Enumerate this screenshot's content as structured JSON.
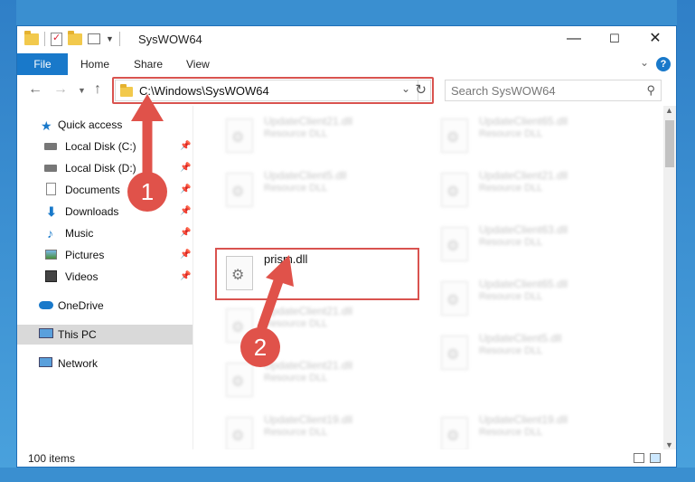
{
  "window": {
    "title": "SysWOW64"
  },
  "ribbon": {
    "tabs": [
      {
        "label": "File"
      },
      {
        "label": "Home"
      },
      {
        "label": "Share"
      },
      {
        "label": "View"
      }
    ],
    "help": "?"
  },
  "nav": {
    "address": "C:\\Windows\\SysWOW64",
    "search_placeholder": "Search SysWOW64"
  },
  "sidebar": {
    "items": [
      {
        "label": "Quick access",
        "icon": "star-icon"
      },
      {
        "label": "Local Disk (C:)",
        "icon": "drive-icon",
        "pinned": true
      },
      {
        "label": "Local Disk (D:)",
        "icon": "drive-icon",
        "pinned": true
      },
      {
        "label": "Documents",
        "icon": "documents-icon",
        "pinned": true
      },
      {
        "label": "Downloads",
        "icon": "download-icon",
        "pinned": true
      },
      {
        "label": "Music",
        "icon": "music-icon",
        "pinned": true
      },
      {
        "label": "Pictures",
        "icon": "pictures-icon",
        "pinned": true
      },
      {
        "label": "Videos",
        "icon": "videos-icon",
        "pinned": true
      },
      {
        "label": "OneDrive",
        "icon": "cloud-icon"
      },
      {
        "label": "This PC",
        "icon": "computer-icon",
        "selected": true
      },
      {
        "label": "Network",
        "icon": "network-icon"
      }
    ]
  },
  "files": {
    "left": [
      {
        "name": "UpdateClient21.dll",
        "type": "Resource DLL"
      },
      {
        "name": "UpdateClient5.dll",
        "type": "Resource DLL"
      },
      {
        "name": "prism.dll",
        "type": ""
      },
      {
        "name": "UpdateClient21.dll",
        "type": "Resource DLL"
      },
      {
        "name": "UpdateClient21.dll",
        "type": "Resource DLL"
      },
      {
        "name": "UpdateClient19.dll",
        "type": "Resource DLL"
      }
    ],
    "right": [
      {
        "name": "UpdateClient65.dll",
        "type": "Resource DLL"
      },
      {
        "name": "UpdateClient21.dll",
        "type": "Resource DLL"
      },
      {
        "name": "UpdateClient63.dll",
        "type": "Resource DLL"
      },
      {
        "name": "UpdateClient65.dll",
        "type": "Resource DLL"
      },
      {
        "name": "UpdateClient5.dll",
        "type": "Resource DLL"
      },
      {
        "name": "UpdateClient19.dll",
        "type": "Resource DLL"
      }
    ]
  },
  "status": {
    "items": "100 items"
  },
  "annotations": {
    "step1": "1",
    "step2": "2",
    "color": "#e0524a"
  }
}
